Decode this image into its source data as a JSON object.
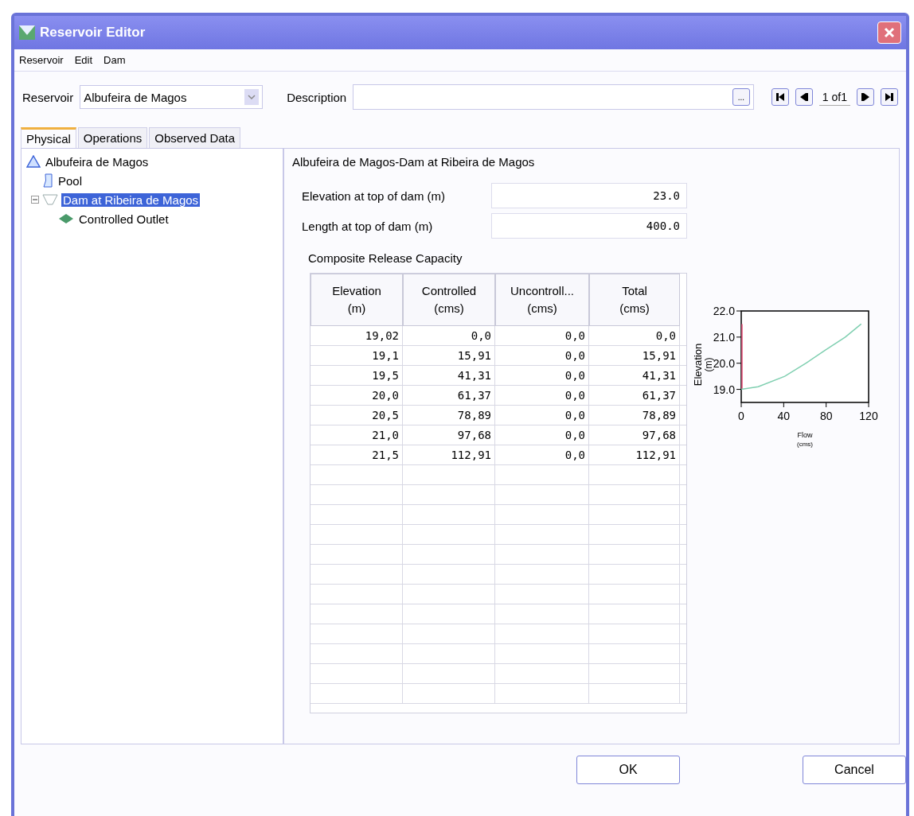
{
  "window": {
    "title": "Reservoir Editor"
  },
  "menu": [
    "Reservoir",
    "Edit",
    "Dam"
  ],
  "selector": {
    "label": "Reservoir",
    "value": "Albufeira de Magos",
    "description_label": "Description",
    "browse": "...",
    "pager": "1 of1"
  },
  "tabs": [
    {
      "label": "Physical",
      "selected": true
    },
    {
      "label": "Operations",
      "selected": false
    },
    {
      "label": "Observed Data",
      "selected": false
    }
  ],
  "tree": [
    {
      "label": "Albufeira de Magos",
      "kind": "reservoir",
      "selected": false,
      "children": [
        {
          "label": "Pool",
          "kind": "pool",
          "selected": false
        },
        {
          "label": "Dam at Ribeira de Magos",
          "kind": "dam",
          "selected": true,
          "expanded": true,
          "children": [
            {
              "label": "Controlled Outlet",
              "kind": "outlet",
              "selected": false
            }
          ]
        }
      ]
    }
  ],
  "detail": {
    "title": "Albufeira de Magos-Dam at Ribeira de Magos",
    "fields": [
      {
        "label": "Elevation at top of dam (m)",
        "value": "23.0"
      },
      {
        "label": "Length at top of dam (m)",
        "value": "400.0"
      }
    ],
    "table_title": "Composite Release Capacity",
    "columns": [
      "Elevation\n(m)",
      "Controlled\n(cms)",
      "Uncontroll...\n(cms)",
      "Total\n(cms)"
    ],
    "rows": [
      [
        "19,02",
        "0,0",
        "0,0",
        "0,0"
      ],
      [
        "19,1",
        "15,91",
        "0,0",
        "15,91"
      ],
      [
        "19,5",
        "41,31",
        "0,0",
        "41,31"
      ],
      [
        "20,0",
        "61,37",
        "0,0",
        "61,37"
      ],
      [
        "20,5",
        "78,89",
        "0,0",
        "78,89"
      ],
      [
        "21,0",
        "97,68",
        "0,0",
        "97,68"
      ],
      [
        "21,5",
        "112,91",
        "0,0",
        "112,91"
      ]
    ],
    "chart_data": {
      "type": "line",
      "xlabel": "Flow (cms)",
      "ylabel": "Elevation (m)",
      "x": [
        0,
        16,
        41,
        61,
        79,
        98,
        113
      ],
      "series": [
        {
          "color": "#7fcfb0",
          "values": [
            19.0,
            19.1,
            19.5,
            20.0,
            20.5,
            21.0,
            21.5
          ]
        }
      ],
      "xlim": [
        0,
        120
      ],
      "ylim": [
        18.5,
        22
      ],
      "xticks": [
        0,
        40,
        80,
        120
      ],
      "yticks": [
        {
          "value": 19,
          "label": "19.0"
        },
        {
          "value": 20,
          "label": "20.0"
        },
        {
          "value": 21,
          "label": "21.0"
        },
        {
          "value": 22,
          "label": "22.0"
        }
      ]
    }
  },
  "buttons": [
    "OK",
    "Cancel"
  ]
}
